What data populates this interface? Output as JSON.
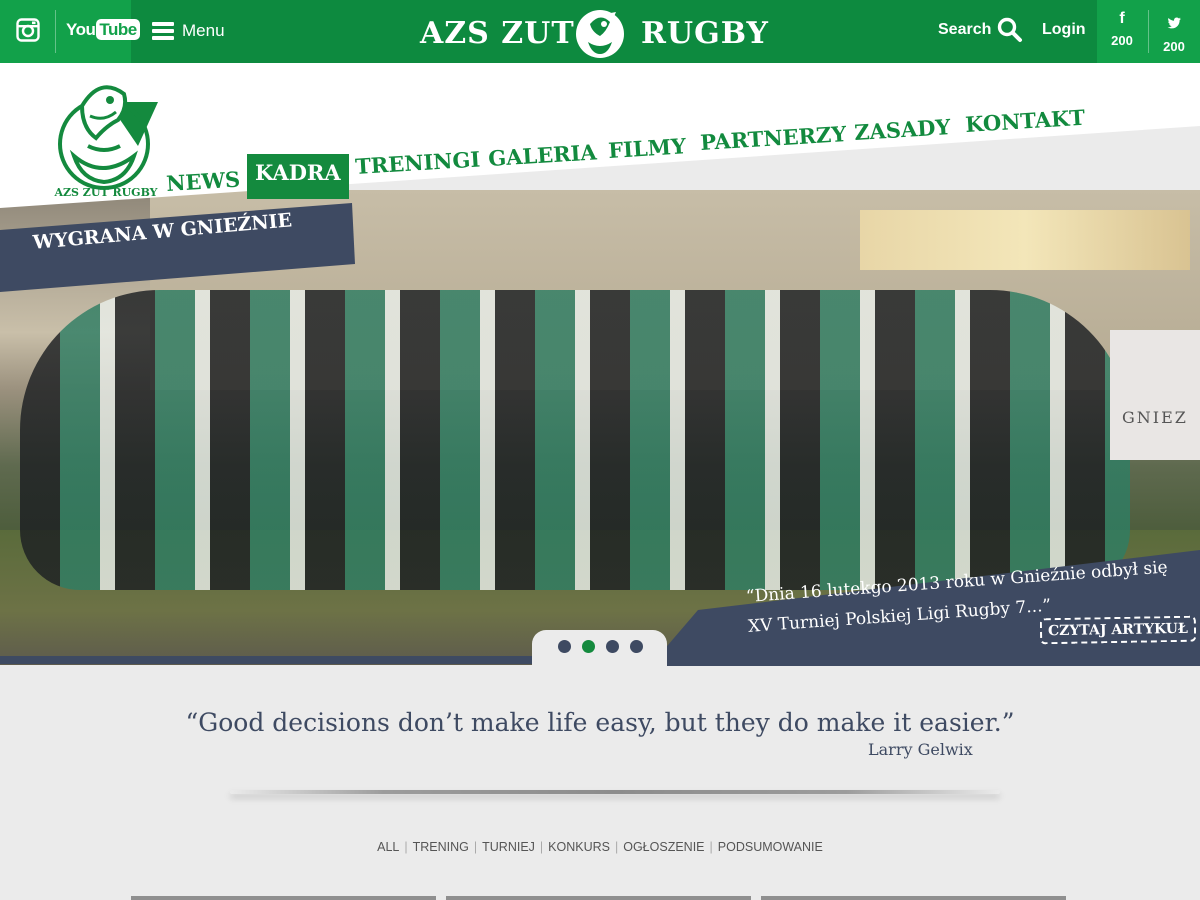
{
  "topbar": {
    "youtube_label": "You",
    "youtube_tube": "Tube",
    "menu_label": "Menu",
    "brand_left": "AZS ZUT",
    "brand_right": "RUGBY",
    "search_label": "Search",
    "login_label": "Login",
    "facebook_count": "200",
    "twitter_count": "200",
    "facebook_icon": "f"
  },
  "logo": {
    "text": "AZS ZUT RUGBY"
  },
  "nav": {
    "items": [
      "NEWS",
      "KADRA",
      "TRENINGI",
      "GALERIA",
      "FILMY",
      "PARTNERZY",
      "ZASADY",
      "KONTAKT"
    ],
    "active": "KADRA"
  },
  "slide": {
    "title": "WYGRANA W GNIEŹNIE",
    "caption": "“Dnia 16 lutekgo 2013 roku w Gnieźnie odbył się XV Turniej Polskiej Ligi Rugby 7...”",
    "read_more": "CZYTAJ ARTYKUŁ",
    "banner_text": "GNIEZ",
    "dots": 4,
    "active_dot": 2
  },
  "quote": {
    "text": "“Good decisions don’t make life easy, but they do make it easier.”",
    "author": "Larry Gelwix"
  },
  "filters": [
    "ALL",
    "TRENING",
    "TURNIEJ",
    "KONKURS",
    "OGŁOSZENIE",
    "PODSUMOWANIE"
  ],
  "colors": {
    "brand_green": "#0d8a3f",
    "light_green": "#12a14a",
    "navy": "#3e4a62",
    "background": "#ebebeb"
  }
}
